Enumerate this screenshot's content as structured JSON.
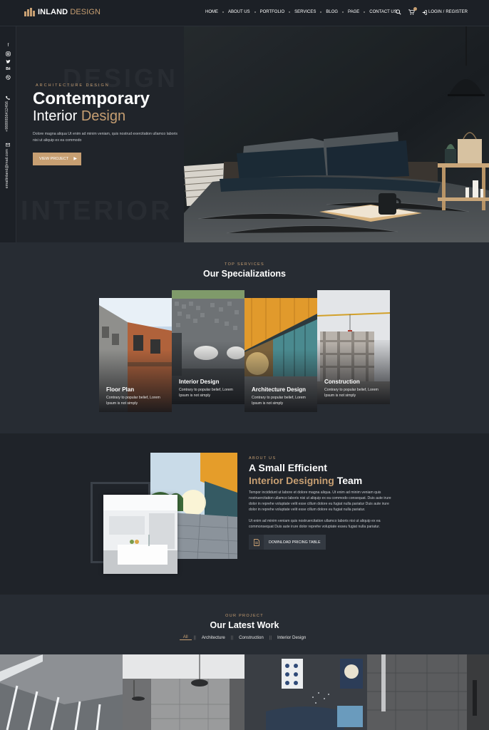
{
  "header": {
    "logo_bold": "INLAND",
    "logo_rest": "DESIGN",
    "nav": [
      "HOME",
      "ABOUT US",
      "PORTFOLIO",
      "SERVICES",
      "BLOG",
      "PAGE",
      "CONTACT US"
    ],
    "login": "LOGIN",
    "divider": "/",
    "register": "REGISTER",
    "icons": [
      "search-icon",
      "cart-icon",
      "login-icon"
    ]
  },
  "sidebar": {
    "social_icons": [
      "facebook-icon",
      "instagram-icon",
      "twitter-icon",
      "behance-icon",
      "dribbble-icon"
    ],
    "phone": "+9889856412456",
    "email": "emailinland@mail.com"
  },
  "hero": {
    "ghost_top": "DESIGN",
    "ghost_bottom": "INTERIOR",
    "kicker": "ARCHITECTURE DESIGN",
    "title_line1": "Contemporary",
    "title_line2_a": "Interior",
    "title_line2_b": "Design",
    "text": "Dolore magna aliqua Ut enim ad minim veniam, quis nostrud exercitation ullamco laboris nisi ut aliquip ex ea commodo",
    "button": "VIEW PROJECT"
  },
  "services": {
    "kicker": "TOP SERVICES",
    "title": "Our Specializations",
    "cards": [
      {
        "title": "Floor Plan",
        "text": "Contrary to popular belief, Lorem Ipsum is not simply"
      },
      {
        "title": "Interior Design",
        "text": "Contrary to popular belief, Lorem Ipsum is not simply"
      },
      {
        "title": "Architecture Design",
        "text": "Contrary to popular belief, Lorem Ipsum is not simply"
      },
      {
        "title": "Construction",
        "text": "Contrary to popular belief, Lorem Ipsum is not simply"
      }
    ]
  },
  "about": {
    "kicker": "ABOUT US",
    "title_line1": "A Small Efficient",
    "title_line2_accent": "Interior Designing",
    "title_line2_rest": "Team",
    "para1": "Tempor incididunt ut labore et dolore magna aliqua. Ut enim ad minim veniam quis nostruercitation ullamco laboris nisi ut aliquip ex ea commodo consequat. Duis aute irure dolor in reprehe voluptate velit esse cillum dolore eu fugiat nulla pariatur Duis aute irure dolor in reprehe voluptate velit esse cillum dolore eu fugiat nulla pariatur.",
    "para2": "Ut enim ad minim veniam quis nostruercitation ullamco laboris nisi ut aliquip ex ea commonsequat Duis aute irure dolor reprehe voluptate esseu fugiat nulla pariatur.",
    "button": "DOWNLOAD PRICING TABLE"
  },
  "projects": {
    "kicker": "OUR PROJECT",
    "title": "Our Latest Work",
    "filters": [
      "All",
      "Architecture",
      "Construction",
      "Interior Design"
    ],
    "filter_separator": "||",
    "active_filter": "All"
  },
  "colors": {
    "accent": "#c79f72",
    "dark_bg": "#1f2329",
    "section_bg": "#272c33"
  }
}
